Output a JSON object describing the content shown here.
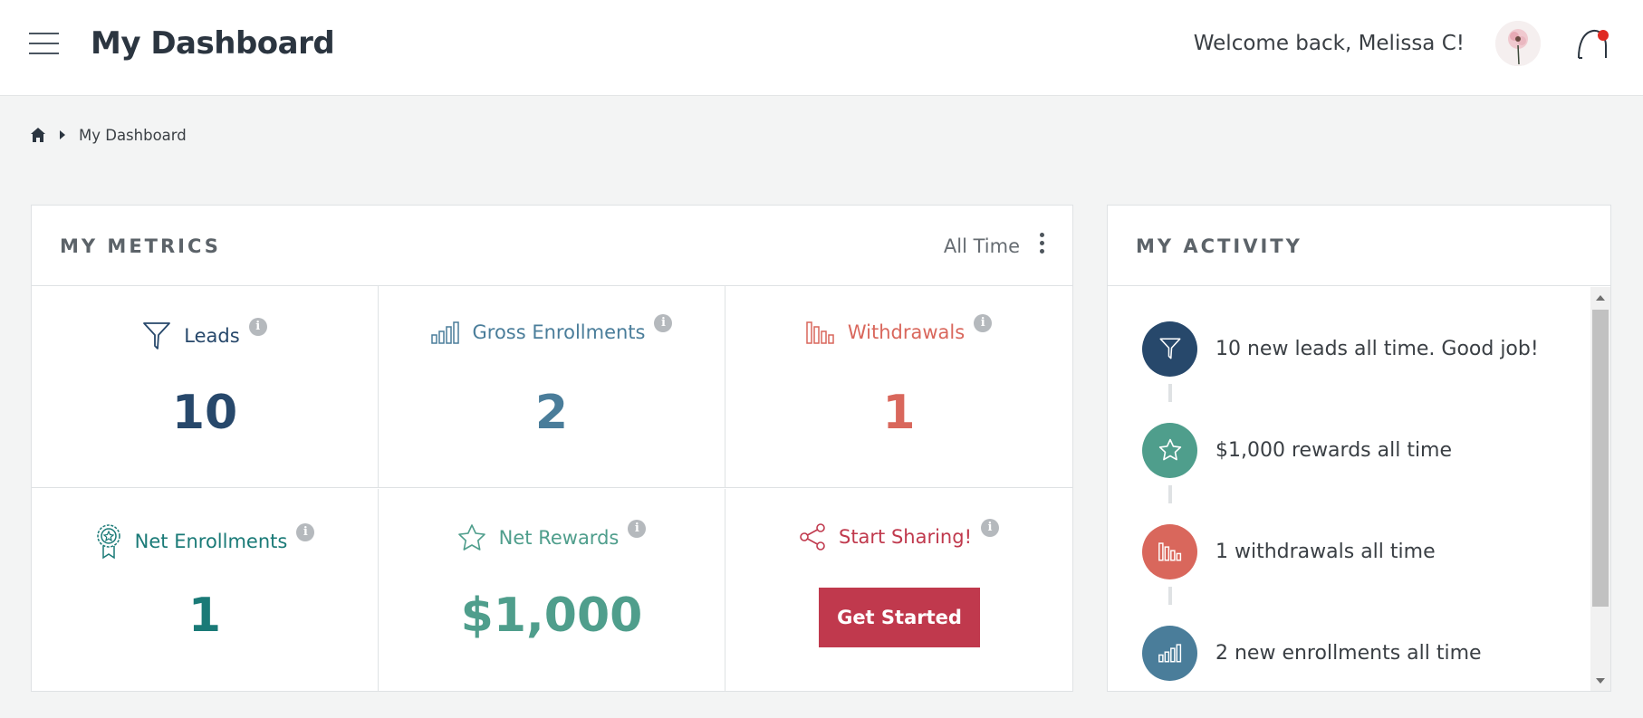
{
  "header": {
    "title": "My Dashboard",
    "welcome": "Welcome back, Melissa C!",
    "icons": {
      "menu": "hamburger-menu-icon",
      "avatar": "user-avatar",
      "notifications": "notification-bell-icon"
    }
  },
  "breadcrumb": {
    "home_icon": "home-icon",
    "current": "My Dashboard"
  },
  "metrics": {
    "title": "MY METRICS",
    "range": "All Time",
    "cells": [
      {
        "label": "Leads",
        "value": "10",
        "icon": "funnel-icon",
        "color": "#27486b"
      },
      {
        "label": "Gross Enrollments",
        "value": "2",
        "icon": "signal-bars-icon",
        "color": "#4a7d9a"
      },
      {
        "label": "Withdrawals",
        "value": "1",
        "icon": "descending-bars-icon",
        "color": "#d9675c"
      },
      {
        "label": "Net Enrollments",
        "value": "1",
        "icon": "award-ribbon-icon",
        "color": "#1a7a77"
      },
      {
        "label": "Net Rewards",
        "value": "$1,000",
        "icon": "star-icon",
        "color": "#4f9e8c"
      },
      {
        "label": "Start Sharing!",
        "button": "Get Started",
        "icon": "share-icon",
        "color": "#c0394d"
      }
    ]
  },
  "activity": {
    "title": "MY ACTIVITY",
    "items": [
      {
        "text": "10 new leads all time. Good job!",
        "icon": "funnel-icon",
        "color": "#27486b"
      },
      {
        "text": "$1,000 rewards all time",
        "icon": "star-icon",
        "color": "#4f9e8c"
      },
      {
        "text": "1 withdrawals all time",
        "icon": "descending-bars-icon",
        "color": "#d9675c"
      },
      {
        "text": "2 new enrollments all time",
        "icon": "signal-bars-icon",
        "color": "#4a7d9a"
      }
    ]
  }
}
